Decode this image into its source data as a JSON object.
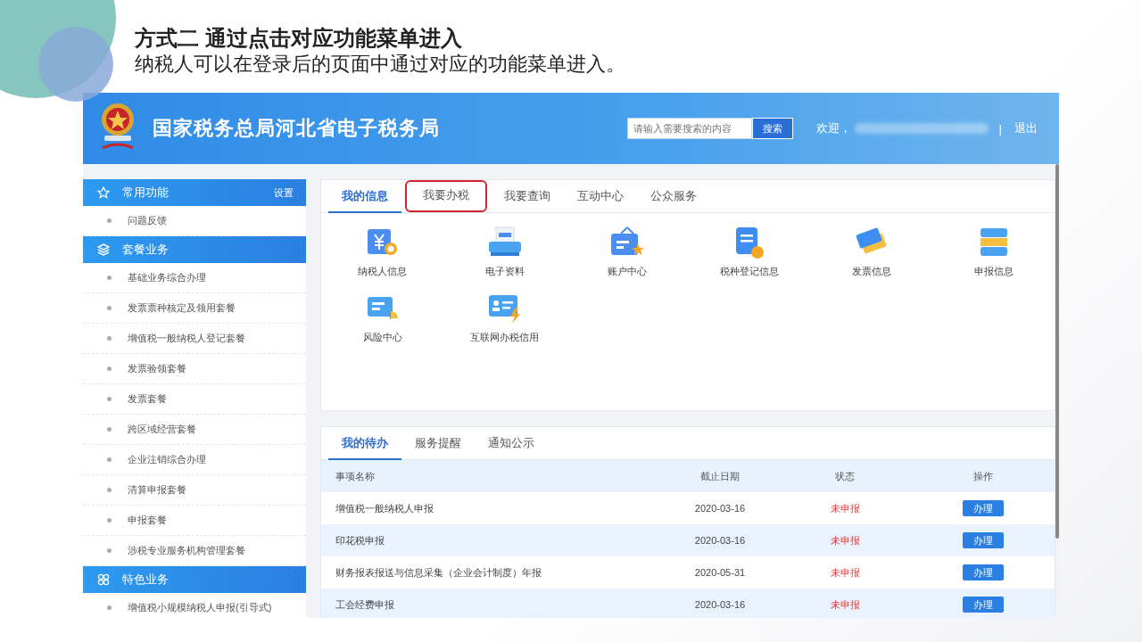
{
  "slide": {
    "title": "方式二 通过点击对应功能菜单进入",
    "subtitle": "纳税人可以在登录后的页面中通过对应的功能菜单进入。"
  },
  "header": {
    "site_title": "国家税务总局河北省电子税务局",
    "search": {
      "placeholder": "请输入需要搜索的内容",
      "button": "搜索"
    },
    "welcome": "欢迎，",
    "separator": "|",
    "logout": "退出"
  },
  "sidebar": [
    {
      "kind": "star",
      "title": "常用功能",
      "action": "设置",
      "items": [
        "问题反馈"
      ]
    },
    {
      "kind": "layers",
      "title": "套餐业务",
      "items": [
        "基础业务综合办理",
        "发票票种核定及领用套餐",
        "增值税一般纳税人登记套餐",
        "发票验领套餐",
        "发票套餐",
        "跨区域经营套餐",
        "企业注销综合办理",
        "清算申报套餐",
        "申报套餐",
        "涉税专业服务机构管理套餐"
      ]
    },
    {
      "kind": "grid",
      "title": "特色业务",
      "items": [
        "增值税小规模纳税人申报(引导式)"
      ]
    }
  ],
  "info_tabs": [
    {
      "label": "我的信息",
      "selected": true,
      "highlighted": false
    },
    {
      "label": "我要办税",
      "selected": false,
      "highlighted": true
    },
    {
      "label": "我要查询",
      "selected": false,
      "highlighted": false
    },
    {
      "label": "互动中心",
      "selected": false,
      "highlighted": false
    },
    {
      "label": "公众服务",
      "selected": false,
      "highlighted": false
    }
  ],
  "functions": [
    {
      "kind": "taxpayer",
      "label": "纳税人信息"
    },
    {
      "kind": "printer",
      "label": "电子资料"
    },
    {
      "kind": "account",
      "label": "账户中心"
    },
    {
      "kind": "register",
      "label": "税种登记信息"
    },
    {
      "kind": "tickets",
      "label": "发票信息"
    },
    {
      "kind": "cabinet",
      "label": "申报信息"
    },
    {
      "kind": "risk",
      "label": "风险中心"
    },
    {
      "kind": "credit",
      "label": "互联网办税信用"
    }
  ],
  "todo_tabs": [
    {
      "label": "我的待办",
      "selected": true
    },
    {
      "label": "服务提醒",
      "selected": false
    },
    {
      "label": "通知公示",
      "selected": false
    }
  ],
  "table": {
    "columns": [
      "事项名称",
      "截止日期",
      "状态",
      "操作"
    ],
    "rows": [
      {
        "name": "增值税一般纳税人申报",
        "date": "2020-03-16",
        "status": "未申报",
        "action": "办理"
      },
      {
        "name": "印花税申报",
        "date": "2020-03-16",
        "status": "未申报",
        "action": "办理"
      },
      {
        "name": "财务报表报送与信息采集（企业会计制度）年报",
        "date": "2020-05-31",
        "status": "未申报",
        "action": "办理"
      },
      {
        "name": "工会经费申报",
        "date": "2020-03-16",
        "status": "未申报",
        "action": "办理"
      }
    ]
  }
}
